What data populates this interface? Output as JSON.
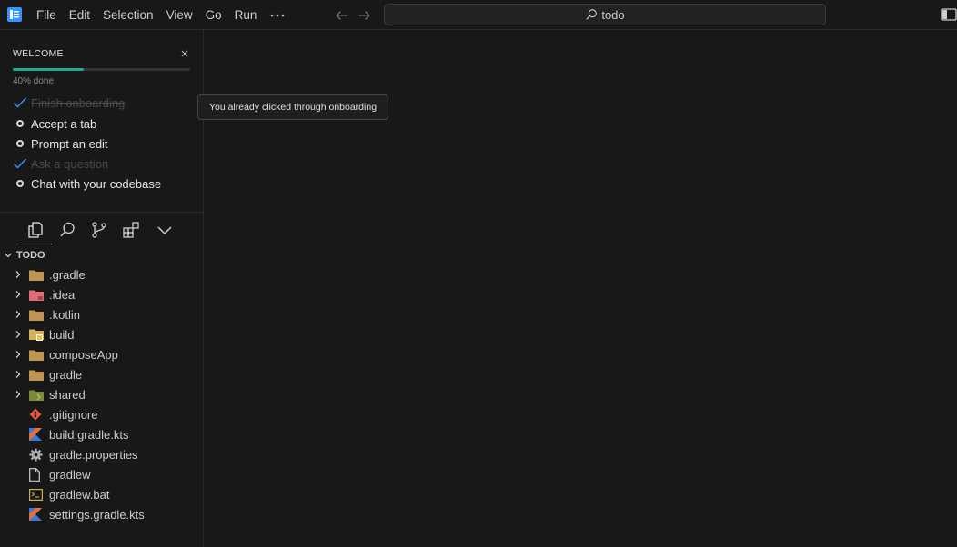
{
  "menu": {
    "items": [
      "File",
      "Edit",
      "Selection",
      "View",
      "Go",
      "Run"
    ],
    "more_icon": "ellipsis-icon"
  },
  "search": {
    "text": "todo"
  },
  "welcome": {
    "title": "WELCOME",
    "progress_percent": 40,
    "progress_label": "40% done",
    "tasks": [
      {
        "label": "Finish onboarding",
        "done": true
      },
      {
        "label": "Accept a tab",
        "done": false
      },
      {
        "label": "Prompt an edit",
        "done": false
      },
      {
        "label": "Ask a question",
        "done": true
      },
      {
        "label": "Chat with your codebase",
        "done": false
      }
    ]
  },
  "tooltip": {
    "text": "You already clicked through onboarding"
  },
  "activity": {
    "items": [
      "explorer-icon",
      "search-icon",
      "source-control-icon",
      "extensions-icon",
      "chevron-down-icon"
    ]
  },
  "explorer": {
    "root": "TODO",
    "entries": [
      {
        "name": ".gradle",
        "type": "folder",
        "icon": "folder-icon"
      },
      {
        "name": ".idea",
        "type": "folder",
        "icon": "idea-folder-icon"
      },
      {
        "name": ".kotlin",
        "type": "folder",
        "icon": "folder-icon"
      },
      {
        "name": "build",
        "type": "folder",
        "icon": "build-folder-icon"
      },
      {
        "name": "composeApp",
        "type": "folder",
        "icon": "folder-icon"
      },
      {
        "name": "gradle",
        "type": "folder",
        "icon": "folder-icon"
      },
      {
        "name": "shared",
        "type": "folder",
        "icon": "shared-folder-icon"
      },
      {
        "name": ".gitignore",
        "type": "file",
        "icon": "git-icon"
      },
      {
        "name": "build.gradle.kts",
        "type": "file",
        "icon": "kotlin-icon"
      },
      {
        "name": "gradle.properties",
        "type": "file",
        "icon": "gear-icon"
      },
      {
        "name": "gradlew",
        "type": "file",
        "icon": "file-icon"
      },
      {
        "name": "gradlew.bat",
        "type": "file",
        "icon": "terminal-icon"
      },
      {
        "name": "settings.gradle.kts",
        "type": "file",
        "icon": "kotlin-icon"
      }
    ]
  },
  "colors": {
    "accent": "#26a69a",
    "background": "#181818",
    "folder": "#c09553",
    "check": "#3794ff"
  }
}
